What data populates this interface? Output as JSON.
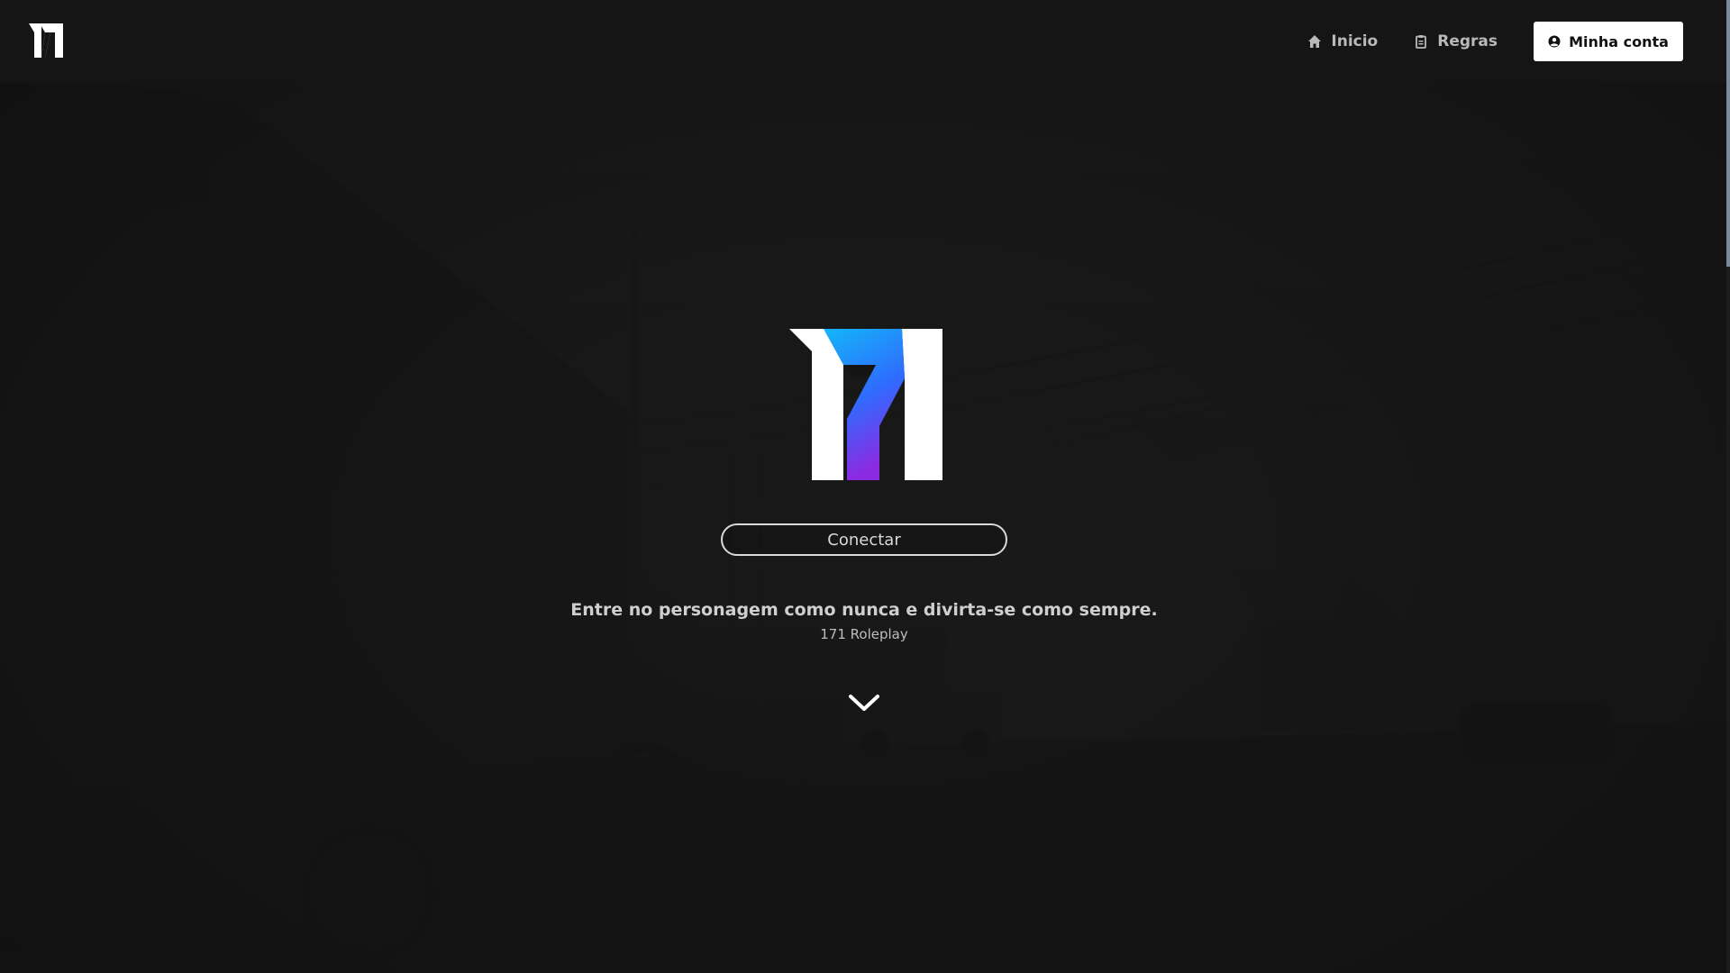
{
  "colors": {
    "background": "#131313",
    "navbar": "#151515",
    "text_muted": "#b9b9b9",
    "accent_red": "#d0202c",
    "logo_gradient_top": "#16a9f5",
    "logo_gradient_bottom": "#8a2be2",
    "account_button_bg": "#ffffff"
  },
  "top_progress": {
    "fraction": 0.17
  },
  "navbar": {
    "logo_icon": "171-logo-icon",
    "links": [
      {
        "label": "Inicio",
        "icon": "home-icon"
      },
      {
        "label": "Regras",
        "icon": "clipboard-icon"
      }
    ],
    "account_button": {
      "label": "Minha conta",
      "icon": "user-circle-icon"
    }
  },
  "hero": {
    "logo_icon": "171-logo-icon",
    "connect_label": "Conectar",
    "tagline": "Entre no personagem como nunca e divirta-se como sempre.",
    "subtitle": "171 Roleplay",
    "scroll_icon": "chevron-down-icon"
  }
}
